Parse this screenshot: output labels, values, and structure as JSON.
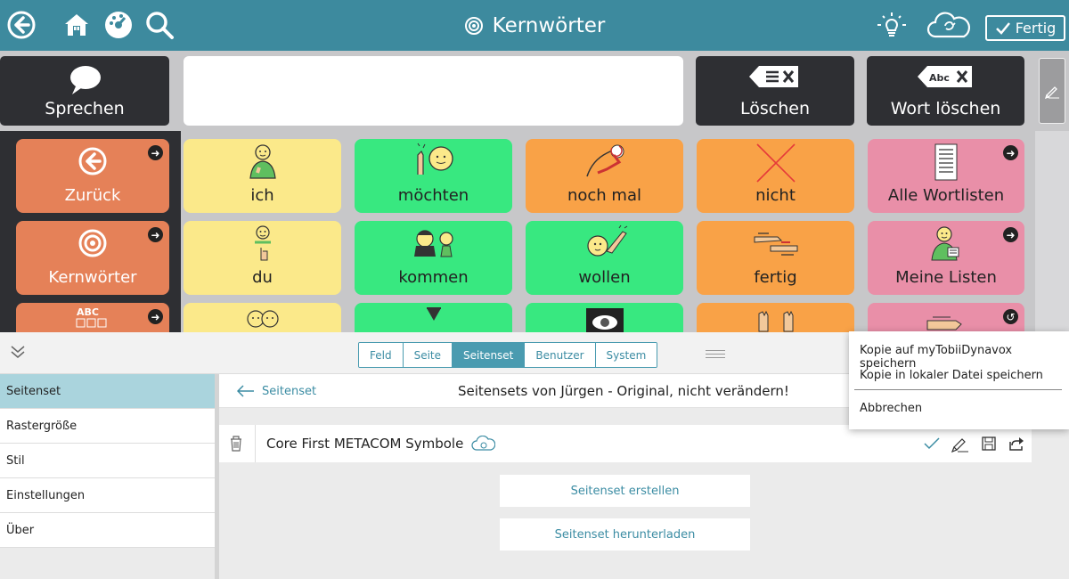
{
  "topbar": {
    "title": "Kernwörter",
    "done_label": "Fertig",
    "icons": [
      "back-icon",
      "home-icon",
      "gauge-icon",
      "search-icon",
      "lightbulb-icon",
      "cloud-sync-icon"
    ]
  },
  "toolbar": {
    "speak_label": "Sprechen",
    "delete_label": "Löschen",
    "delete_word_label": "Wort löschen",
    "delete_word_icon_text": "Abc"
  },
  "grid": {
    "left": [
      {
        "label": "Zurück",
        "icon": "arrow-left-icon"
      },
      {
        "label": "Kernwörter",
        "icon": "target-icon"
      },
      {
        "label": "",
        "icon": "abc-grid-icon",
        "icon_text": "ABC"
      }
    ],
    "cells": [
      {
        "label": "ich",
        "color": "#fbe98a"
      },
      {
        "label": "möchten",
        "color": "#38e880"
      },
      {
        "label": "noch mal",
        "color": "#f9a247"
      },
      {
        "label": "nicht",
        "color": "#f9a247"
      },
      {
        "label": "Alle Wortlisten",
        "color": "#e98fa8"
      },
      {
        "label": "du",
        "color": "#fbe98a"
      },
      {
        "label": "kommen",
        "color": "#38e880"
      },
      {
        "label": "wollen",
        "color": "#38e880"
      },
      {
        "label": "fertig",
        "color": "#f9a247"
      },
      {
        "label": "Meine Listen",
        "color": "#e98fa8"
      }
    ]
  },
  "panel": {
    "tabs": [
      "Feld",
      "Seite",
      "Seitenset",
      "Benutzer",
      "System"
    ],
    "active_tab": "Seitenset",
    "sidebar": [
      "Seitenset",
      "Rastergröße",
      "Stil",
      "Einstellungen",
      "Über"
    ],
    "back_label": "Seitenset",
    "content_title": "Seitensets von Jürgen - Original, nicht verändern!",
    "pageset_name": "Core First METACOM Symbole",
    "create_label": "Seitenset erstellen",
    "download_label": "Seitenset herunterladen"
  },
  "popup": {
    "items": [
      "Kopie auf myTobiiDynavox speichern",
      "Kopie in lokaler Datei speichern",
      "Abbrechen"
    ]
  }
}
